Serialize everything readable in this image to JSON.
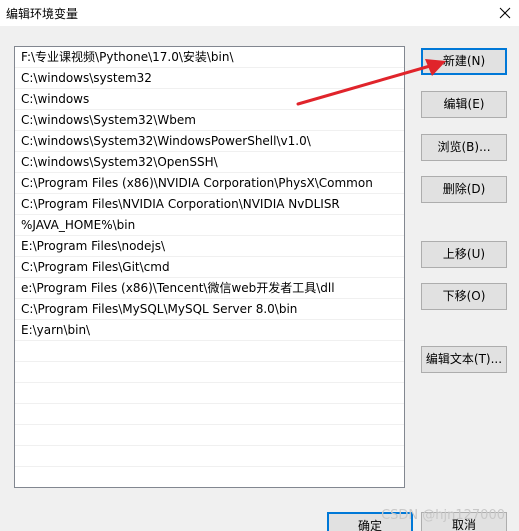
{
  "window": {
    "title": "编辑环境变量"
  },
  "path_list": {
    "items": [
      "F:\\专业课视频\\Pythone\\17.0\\安装\\bin\\",
      "C:\\windows\\system32",
      "C:\\windows",
      "C:\\windows\\System32\\Wbem",
      "C:\\windows\\System32\\WindowsPowerShell\\v1.0\\",
      "C:\\windows\\System32\\OpenSSH\\",
      "C:\\Program Files (x86)\\NVIDIA Corporation\\PhysX\\Common",
      "C:\\Program Files\\NVIDIA Corporation\\NVIDIA NvDLISR",
      "%JAVA_HOME%\\bin",
      "E:\\Program Files\\nodejs\\",
      "C:\\Program Files\\Git\\cmd",
      "e:\\Program Files (x86)\\Tencent\\微信web开发者工具\\dll",
      "C:\\Program Files\\MySQL\\MySQL Server 8.0\\bin",
      "E:\\yarn\\bin\\"
    ]
  },
  "buttons": {
    "new": "新建(N)",
    "edit": "编辑(E)",
    "browse": "浏览(B)...",
    "delete": "删除(D)",
    "move_up": "上移(U)",
    "move_down": "下移(O)",
    "edit_text": "编辑文本(T)...",
    "ok": "确定",
    "cancel": "取消"
  },
  "watermark": "CSDN @hjn127000",
  "colors": {
    "accent": "#0078d7",
    "arrow": "#e0242b"
  }
}
